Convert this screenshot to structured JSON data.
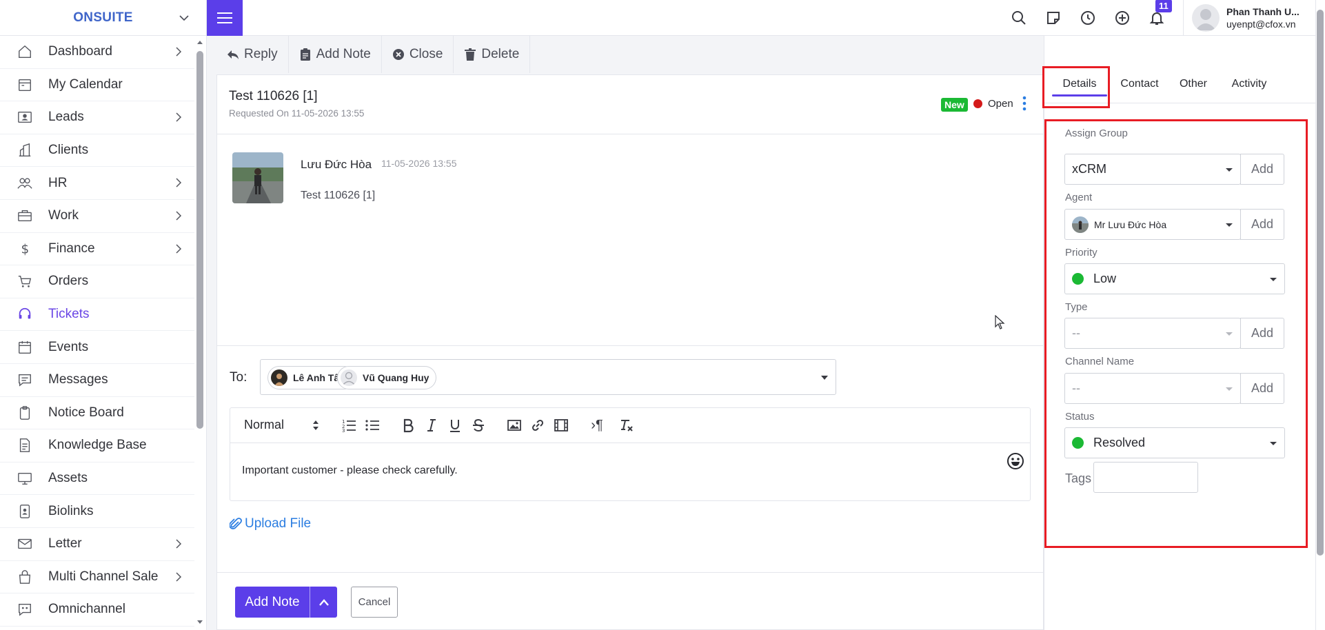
{
  "brand": {
    "name": "ONSUITE"
  },
  "sidebar": {
    "items": [
      {
        "label": "Dashboard",
        "icon": "home-icon",
        "has_children": true
      },
      {
        "label": "My Calendar",
        "icon": "calendar-icon",
        "has_children": false
      },
      {
        "label": "Leads",
        "icon": "contact-card-icon",
        "has_children": true
      },
      {
        "label": "Clients",
        "icon": "building-icon",
        "has_children": false
      },
      {
        "label": "HR",
        "icon": "people-icon",
        "has_children": true
      },
      {
        "label": "Work",
        "icon": "briefcase-icon",
        "has_children": true
      },
      {
        "label": "Finance",
        "icon": "dollar-icon",
        "has_children": true
      },
      {
        "label": "Orders",
        "icon": "cart-icon",
        "has_children": false
      },
      {
        "label": "Tickets",
        "icon": "headset-icon",
        "has_children": false,
        "active": true
      },
      {
        "label": "Events",
        "icon": "event-calendar-icon",
        "has_children": false
      },
      {
        "label": "Messages",
        "icon": "message-icon",
        "has_children": false
      },
      {
        "label": "Notice Board",
        "icon": "clipboard-icon",
        "has_children": false
      },
      {
        "label": "Knowledge Base",
        "icon": "document-icon",
        "has_children": false
      },
      {
        "label": "Assets",
        "icon": "monitor-icon",
        "has_children": false
      },
      {
        "label": "Biolinks",
        "icon": "id-badge-icon",
        "has_children": false
      },
      {
        "label": "Letter",
        "icon": "envelope-icon",
        "has_children": true
      },
      {
        "label": "Multi Channel Sale",
        "icon": "bag-icon",
        "has_children": true
      },
      {
        "label": "Omnichannel",
        "icon": "chat-quote-icon",
        "has_children": false
      }
    ]
  },
  "topbar": {
    "notification_count": "11",
    "user_name": "Phan Thanh U...",
    "user_email": "uyenpt@cfox.vn"
  },
  "actions": {
    "reply": "Reply",
    "add_note": "Add Note",
    "close": "Close",
    "delete": "Delete"
  },
  "ticket": {
    "title": "Test 110626 [1]",
    "requested_on": "Requested On 11-05-2026 13:55",
    "badge": "New",
    "status": "Open"
  },
  "message": {
    "author": "Lưu Đức Hòa",
    "time": "11-05-2026 13:55",
    "body": "Test 110626 [1]"
  },
  "reply_form": {
    "to_label": "To:",
    "recipients": [
      "Lê Anh Tâm",
      "Vũ Quang Huy"
    ],
    "format": "Normal",
    "content": "Important customer - please check carefully.",
    "upload_label": "Upload File",
    "submit_label": "Add Note",
    "cancel_label": "Cancel"
  },
  "panel": {
    "tabs": [
      "Details",
      "Contact",
      "Other",
      "Activity"
    ],
    "add_label": "Add",
    "assign_group": {
      "label": "Assign Group",
      "value": "xCRM"
    },
    "agent": {
      "label": "Agent",
      "value": "Mr Lưu Đức Hòa"
    },
    "priority": {
      "label": "Priority",
      "value": "Low"
    },
    "type": {
      "label": "Type",
      "value": "--"
    },
    "channel": {
      "label": "Channel Name",
      "value": "--"
    },
    "status": {
      "label": "Status",
      "value": "Resolved"
    },
    "tags": {
      "label": "Tags"
    }
  },
  "colors": {
    "accent": "#5b3ee9",
    "brand": "#3f65c9",
    "highlight": "#e81c24",
    "success": "#1bb934",
    "danger": "#d41a1a",
    "link": "#2b7de1"
  }
}
